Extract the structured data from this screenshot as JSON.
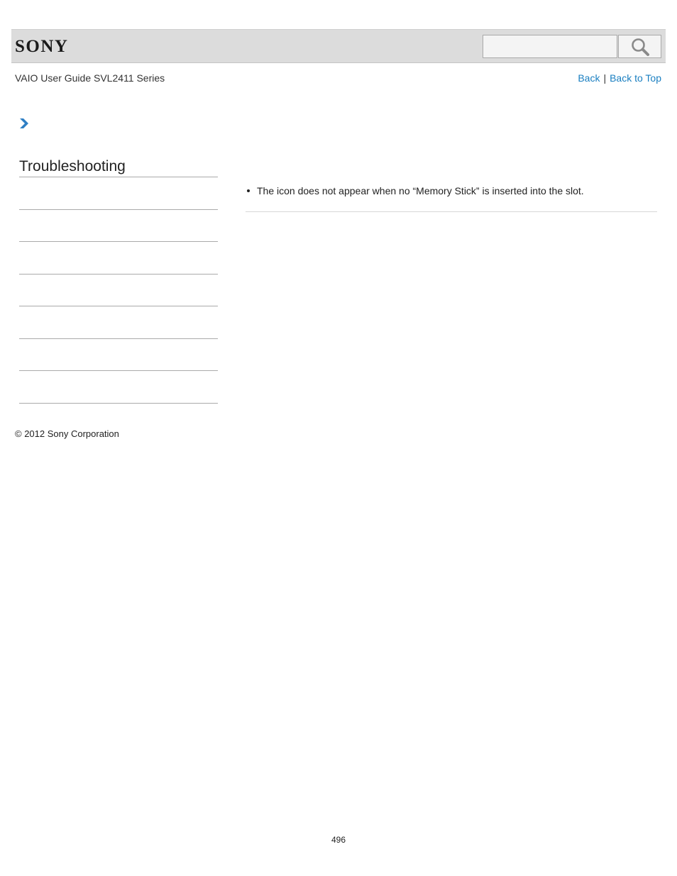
{
  "header": {
    "logo_text": "SONY",
    "search": {
      "value": "",
      "icon": "search-icon"
    }
  },
  "subheader": {
    "guide_title": "VAIO User Guide SVL2411 Series",
    "links": {
      "back": "Back",
      "separator": "|",
      "back_to_top": "Back to Top"
    }
  },
  "breadcrumb": {
    "icon": "chevron-right-icon"
  },
  "sidebar": {
    "title": "Troubleshooting"
  },
  "content": {
    "items": [
      "The icon does not appear when no “Memory Stick” is inserted into the slot."
    ]
  },
  "footer": {
    "copyright": "© 2012 Sony Corporation",
    "page_number": "496"
  },
  "colors": {
    "link": "#1a7fc1",
    "header_bg": "#dcdcdc",
    "chevron": "#2f7fc4"
  }
}
